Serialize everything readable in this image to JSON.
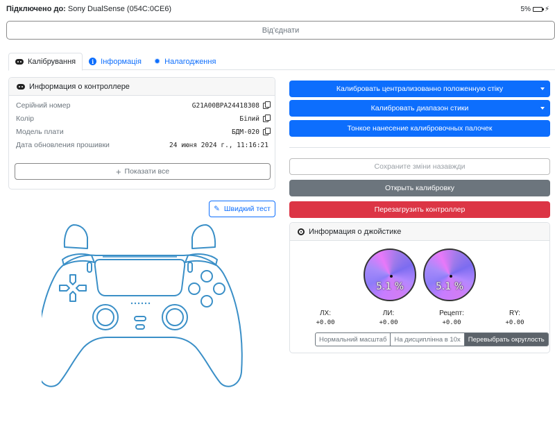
{
  "header": {
    "connected_label": "Підключено до:",
    "device": "Sony DualSense (054C:0CE6)",
    "battery": "5%"
  },
  "disconnect_label": "Від'єднати",
  "tabs": [
    {
      "label": "Калібрування",
      "icon": "gamepad-icon",
      "active": true
    },
    {
      "label": "Інформація",
      "icon": "info-icon",
      "active": false
    },
    {
      "label": "Налагодження",
      "icon": "bug-icon",
      "active": false
    }
  ],
  "controller_info": {
    "title": "Информация о контроллере",
    "rows": [
      {
        "label": "Серійний номер",
        "value": "G21A00BPA24418308"
      },
      {
        "label": "Колір",
        "value": "Білий"
      },
      {
        "label": "Модель плати",
        "value": "БДМ-020"
      },
      {
        "label": "Дата обновления прошивки",
        "value": "24 июня 2024 г., 11:16:21"
      }
    ],
    "show_all": "Показати все"
  },
  "quick_test": "Швидкий тест",
  "actions": {
    "calibrate_center": "Калибровать централизованно положенную стіку",
    "calibrate_range": "Калибровать диапазон стики",
    "fine_calibration": "Тонкое нанесение калибровочных палочек",
    "save_changes": "Сохраните зміни назавжди",
    "open_calibration": "Открыть калибровку",
    "restart_controller": "Перезагрузить контроллер"
  },
  "joystick_info": {
    "title": "Информация о джойстике",
    "left_stick_pct": "5.1 %",
    "right_stick_pct": "5.1 %",
    "axes": [
      {
        "label": "ЛХ:",
        "value": "+0.00"
      },
      {
        "label": "ЛИ:",
        "value": "+0.00"
      },
      {
        "label": "Рецепт:",
        "value": "+0.00"
      },
      {
        "label": "RY:",
        "value": "+0.00"
      }
    ],
    "modes": [
      "Нормальний масштаб",
      "На дисциплінна в 10х",
      "Перевыбрать округлость"
    ]
  },
  "colors": {
    "primary": "#0d6efd",
    "danger": "#dc3545",
    "secondary": "#6c757d",
    "controller_outline": "#3a8fc7"
  }
}
